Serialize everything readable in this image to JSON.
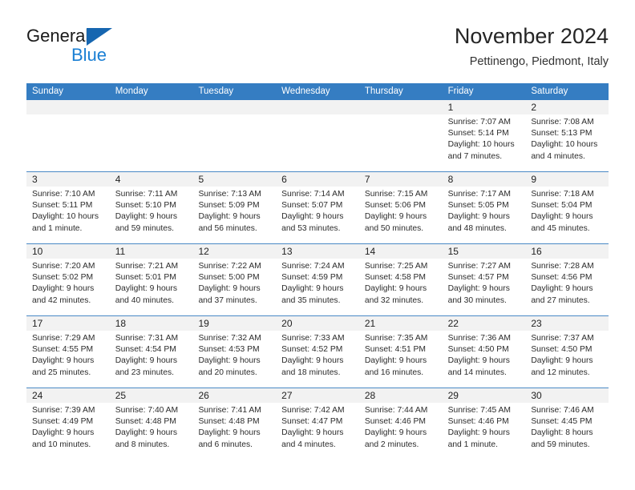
{
  "brand": {
    "name_part1": "General",
    "name_part2": "Blue",
    "triangle_color": "#1666b0",
    "blue_color": "#1a7fd4"
  },
  "header": {
    "title": "November 2024",
    "subtitle": "Pettinengo, Piedmont, Italy"
  },
  "theme": {
    "header_bg": "#357dc2",
    "day_band_bg": "#f2f2f2",
    "grid_line": "#4a89c6"
  },
  "weekdays": [
    "Sunday",
    "Monday",
    "Tuesday",
    "Wednesday",
    "Thursday",
    "Friday",
    "Saturday"
  ],
  "weeks": [
    [
      {
        "empty": true
      },
      {
        "empty": true
      },
      {
        "empty": true
      },
      {
        "empty": true
      },
      {
        "empty": true
      },
      {
        "day": "1",
        "sunrise": "Sunrise: 7:07 AM",
        "sunset": "Sunset: 5:14 PM",
        "daylight1": "Daylight: 10 hours",
        "daylight2": "and 7 minutes."
      },
      {
        "day": "2",
        "sunrise": "Sunrise: 7:08 AM",
        "sunset": "Sunset: 5:13 PM",
        "daylight1": "Daylight: 10 hours",
        "daylight2": "and 4 minutes."
      }
    ],
    [
      {
        "day": "3",
        "sunrise": "Sunrise: 7:10 AM",
        "sunset": "Sunset: 5:11 PM",
        "daylight1": "Daylight: 10 hours",
        "daylight2": "and 1 minute."
      },
      {
        "day": "4",
        "sunrise": "Sunrise: 7:11 AM",
        "sunset": "Sunset: 5:10 PM",
        "daylight1": "Daylight: 9 hours",
        "daylight2": "and 59 minutes."
      },
      {
        "day": "5",
        "sunrise": "Sunrise: 7:13 AM",
        "sunset": "Sunset: 5:09 PM",
        "daylight1": "Daylight: 9 hours",
        "daylight2": "and 56 minutes."
      },
      {
        "day": "6",
        "sunrise": "Sunrise: 7:14 AM",
        "sunset": "Sunset: 5:07 PM",
        "daylight1": "Daylight: 9 hours",
        "daylight2": "and 53 minutes."
      },
      {
        "day": "7",
        "sunrise": "Sunrise: 7:15 AM",
        "sunset": "Sunset: 5:06 PM",
        "daylight1": "Daylight: 9 hours",
        "daylight2": "and 50 minutes."
      },
      {
        "day": "8",
        "sunrise": "Sunrise: 7:17 AM",
        "sunset": "Sunset: 5:05 PM",
        "daylight1": "Daylight: 9 hours",
        "daylight2": "and 48 minutes."
      },
      {
        "day": "9",
        "sunrise": "Sunrise: 7:18 AM",
        "sunset": "Sunset: 5:04 PM",
        "daylight1": "Daylight: 9 hours",
        "daylight2": "and 45 minutes."
      }
    ],
    [
      {
        "day": "10",
        "sunrise": "Sunrise: 7:20 AM",
        "sunset": "Sunset: 5:02 PM",
        "daylight1": "Daylight: 9 hours",
        "daylight2": "and 42 minutes."
      },
      {
        "day": "11",
        "sunrise": "Sunrise: 7:21 AM",
        "sunset": "Sunset: 5:01 PM",
        "daylight1": "Daylight: 9 hours",
        "daylight2": "and 40 minutes."
      },
      {
        "day": "12",
        "sunrise": "Sunrise: 7:22 AM",
        "sunset": "Sunset: 5:00 PM",
        "daylight1": "Daylight: 9 hours",
        "daylight2": "and 37 minutes."
      },
      {
        "day": "13",
        "sunrise": "Sunrise: 7:24 AM",
        "sunset": "Sunset: 4:59 PM",
        "daylight1": "Daylight: 9 hours",
        "daylight2": "and 35 minutes."
      },
      {
        "day": "14",
        "sunrise": "Sunrise: 7:25 AM",
        "sunset": "Sunset: 4:58 PM",
        "daylight1": "Daylight: 9 hours",
        "daylight2": "and 32 minutes."
      },
      {
        "day": "15",
        "sunrise": "Sunrise: 7:27 AM",
        "sunset": "Sunset: 4:57 PM",
        "daylight1": "Daylight: 9 hours",
        "daylight2": "and 30 minutes."
      },
      {
        "day": "16",
        "sunrise": "Sunrise: 7:28 AM",
        "sunset": "Sunset: 4:56 PM",
        "daylight1": "Daylight: 9 hours",
        "daylight2": "and 27 minutes."
      }
    ],
    [
      {
        "day": "17",
        "sunrise": "Sunrise: 7:29 AM",
        "sunset": "Sunset: 4:55 PM",
        "daylight1": "Daylight: 9 hours",
        "daylight2": "and 25 minutes."
      },
      {
        "day": "18",
        "sunrise": "Sunrise: 7:31 AM",
        "sunset": "Sunset: 4:54 PM",
        "daylight1": "Daylight: 9 hours",
        "daylight2": "and 23 minutes."
      },
      {
        "day": "19",
        "sunrise": "Sunrise: 7:32 AM",
        "sunset": "Sunset: 4:53 PM",
        "daylight1": "Daylight: 9 hours",
        "daylight2": "and 20 minutes."
      },
      {
        "day": "20",
        "sunrise": "Sunrise: 7:33 AM",
        "sunset": "Sunset: 4:52 PM",
        "daylight1": "Daylight: 9 hours",
        "daylight2": "and 18 minutes."
      },
      {
        "day": "21",
        "sunrise": "Sunrise: 7:35 AM",
        "sunset": "Sunset: 4:51 PM",
        "daylight1": "Daylight: 9 hours",
        "daylight2": "and 16 minutes."
      },
      {
        "day": "22",
        "sunrise": "Sunrise: 7:36 AM",
        "sunset": "Sunset: 4:50 PM",
        "daylight1": "Daylight: 9 hours",
        "daylight2": "and 14 minutes."
      },
      {
        "day": "23",
        "sunrise": "Sunrise: 7:37 AM",
        "sunset": "Sunset: 4:50 PM",
        "daylight1": "Daylight: 9 hours",
        "daylight2": "and 12 minutes."
      }
    ],
    [
      {
        "day": "24",
        "sunrise": "Sunrise: 7:39 AM",
        "sunset": "Sunset: 4:49 PM",
        "daylight1": "Daylight: 9 hours",
        "daylight2": "and 10 minutes."
      },
      {
        "day": "25",
        "sunrise": "Sunrise: 7:40 AM",
        "sunset": "Sunset: 4:48 PM",
        "daylight1": "Daylight: 9 hours",
        "daylight2": "and 8 minutes."
      },
      {
        "day": "26",
        "sunrise": "Sunrise: 7:41 AM",
        "sunset": "Sunset: 4:48 PM",
        "daylight1": "Daylight: 9 hours",
        "daylight2": "and 6 minutes."
      },
      {
        "day": "27",
        "sunrise": "Sunrise: 7:42 AM",
        "sunset": "Sunset: 4:47 PM",
        "daylight1": "Daylight: 9 hours",
        "daylight2": "and 4 minutes."
      },
      {
        "day": "28",
        "sunrise": "Sunrise: 7:44 AM",
        "sunset": "Sunset: 4:46 PM",
        "daylight1": "Daylight: 9 hours",
        "daylight2": "and 2 minutes."
      },
      {
        "day": "29",
        "sunrise": "Sunrise: 7:45 AM",
        "sunset": "Sunset: 4:46 PM",
        "daylight1": "Daylight: 9 hours",
        "daylight2": "and 1 minute."
      },
      {
        "day": "30",
        "sunrise": "Sunrise: 7:46 AM",
        "sunset": "Sunset: 4:45 PM",
        "daylight1": "Daylight: 8 hours",
        "daylight2": "and 59 minutes."
      }
    ]
  ]
}
